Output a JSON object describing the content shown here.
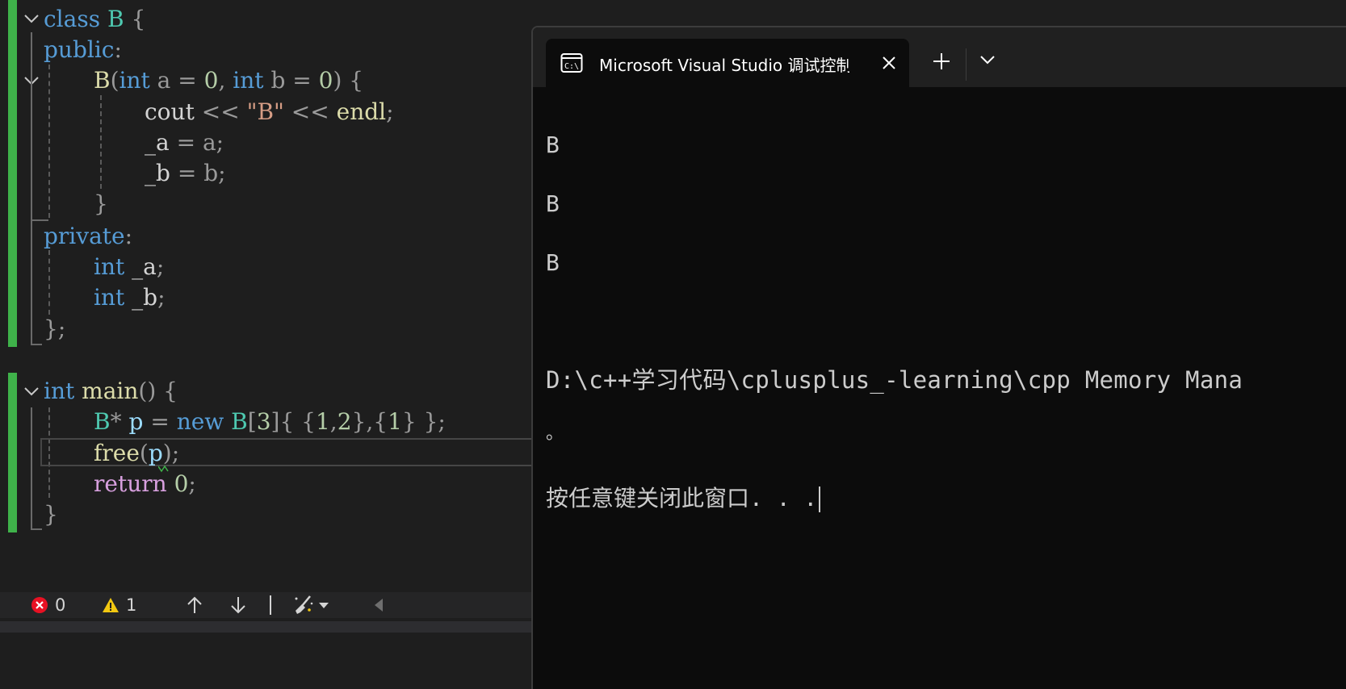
{
  "editor": {
    "lines": [
      [
        "class",
        " ",
        "B",
        " {"
      ],
      [
        "public",
        ":"
      ],
      [
        "B",
        "(",
        "int",
        " ",
        "a",
        " = ",
        "0",
        ", ",
        "int",
        " ",
        "b",
        " = ",
        "0",
        ") {"
      ],
      [
        "cout",
        " << ",
        "\"B\"",
        " << ",
        "endl",
        ";"
      ],
      [
        "_a",
        " = ",
        "a",
        ";"
      ],
      [
        "_b",
        " = ",
        "b",
        ";"
      ],
      [
        "}"
      ],
      [
        "private",
        ":"
      ],
      [
        "int",
        " ",
        "_a",
        ";"
      ],
      [
        "int",
        " ",
        "_b",
        ";"
      ],
      [
        "};"
      ],
      [
        "int",
        " ",
        "main",
        "() {"
      ],
      [
        "B",
        "* ",
        "p",
        " = ",
        "new",
        " ",
        "B",
        "[",
        "3",
        "]{ {",
        "1",
        ",",
        "2",
        "},{",
        "1",
        "} };"
      ],
      [
        "free",
        "(",
        "p",
        ");"
      ],
      [
        "return",
        " ",
        "0",
        ";"
      ],
      [
        "}"
      ]
    ]
  },
  "status": {
    "errors": "0",
    "warnings": "1",
    "colors": {
      "error": "#e81123",
      "warning": "#f2c811"
    }
  },
  "console": {
    "tab_title": "Microsoft Visual Studio 调试控制台",
    "output": {
      "line1": "B",
      "line2": "B",
      "line3": "B",
      "path": "D:\\c++学习代码\\cplusplus_-learning\\cpp Memory Mana",
      "stop": "。",
      "prompt": "按任意键关闭此窗口. . ."
    }
  },
  "icons": [
    "fold-chevron-icon",
    "error-icon",
    "warning-icon",
    "arrow-up-icon",
    "arrow-down-icon",
    "cleanup-brush-icon",
    "dropdown-icon",
    "scroll-left-icon",
    "console-icon",
    "close-icon",
    "plus-icon",
    "chevron-down-icon"
  ]
}
